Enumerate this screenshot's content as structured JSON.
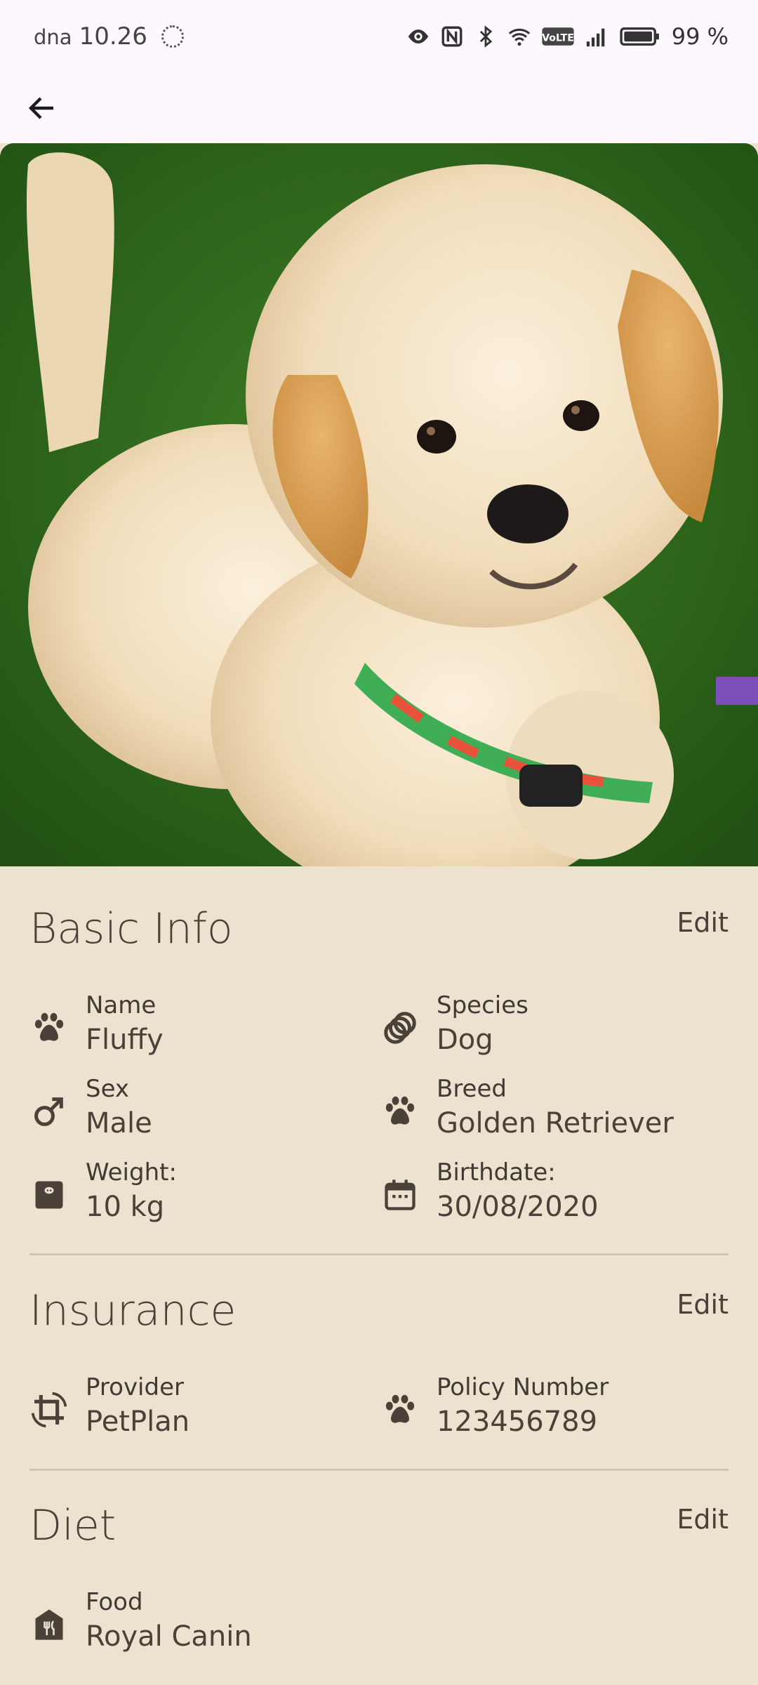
{
  "status_bar": {
    "carrier": "dna",
    "time": "10.26",
    "battery": "99 %",
    "icons": [
      "eye-icon",
      "nfc-icon",
      "bluetooth-icon",
      "wifi-icon",
      "volte-icon",
      "signal-icon",
      "battery-icon"
    ]
  },
  "app_bar": {
    "back_icon": "arrow-back-icon"
  },
  "photo": {
    "subject": "puppy-photo"
  },
  "basic_info": {
    "title": "Basic Info",
    "edit": "Edit",
    "fields": [
      {
        "label": "Name",
        "value": "Fluffy",
        "icon": "paw-icon"
      },
      {
        "label": "Species",
        "value": "Dog",
        "icon": "rings-icon"
      },
      {
        "label": "Sex",
        "value": "Male",
        "icon": "male-icon"
      },
      {
        "label": "Breed",
        "value": "Golden Retriever",
        "icon": "paw-icon"
      },
      {
        "label": "Weight:",
        "value": "10 kg",
        "icon": "scale-icon"
      },
      {
        "label": "Birthdate:",
        "value": "30/08/2020",
        "icon": "calendar-icon"
      }
    ]
  },
  "insurance": {
    "title": "Insurance",
    "edit": "Edit",
    "fields": [
      {
        "label": "Provider",
        "value": "PetPlan",
        "icon": "crop-rotate-icon"
      },
      {
        "label": "Policy Number",
        "value": "123456789",
        "icon": "paw-icon"
      }
    ]
  },
  "diet": {
    "title": "Diet",
    "edit": "Edit",
    "fields": [
      {
        "label": "Food",
        "value": "Royal Canin",
        "icon": "restaurant-icon"
      }
    ]
  },
  "colors": {
    "background": "#ede1cf",
    "text": "#4a4239",
    "divider": "#cfc5b6",
    "topbar": "#fdf8fd"
  }
}
